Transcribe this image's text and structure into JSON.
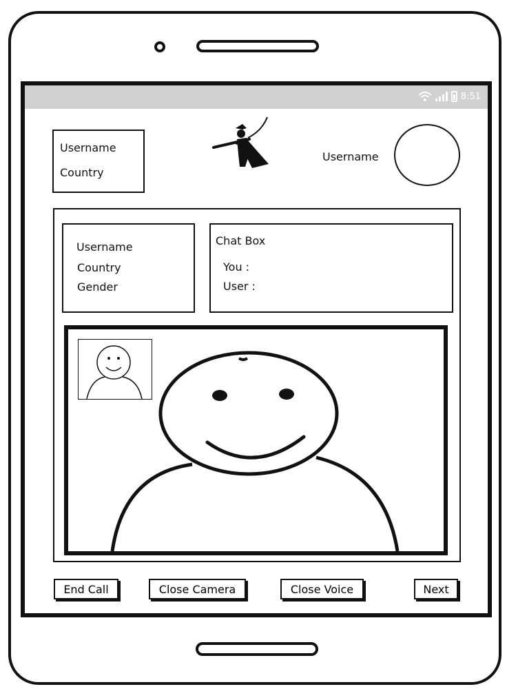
{
  "status_bar": {
    "time": "8:51"
  },
  "header": {
    "user_card": {
      "username": "Username",
      "country": "Country"
    },
    "peer_username": "Username"
  },
  "info_panel": {
    "username": "Username",
    "country": "Country",
    "gender": "Gender"
  },
  "chat_box": {
    "title": "Chat Box",
    "you_label": "You :",
    "user_label": "User :"
  },
  "controls": {
    "end_call": "End Call",
    "close_camera": "Close Camera",
    "close_voice": "Close Voice",
    "next": "Next"
  }
}
